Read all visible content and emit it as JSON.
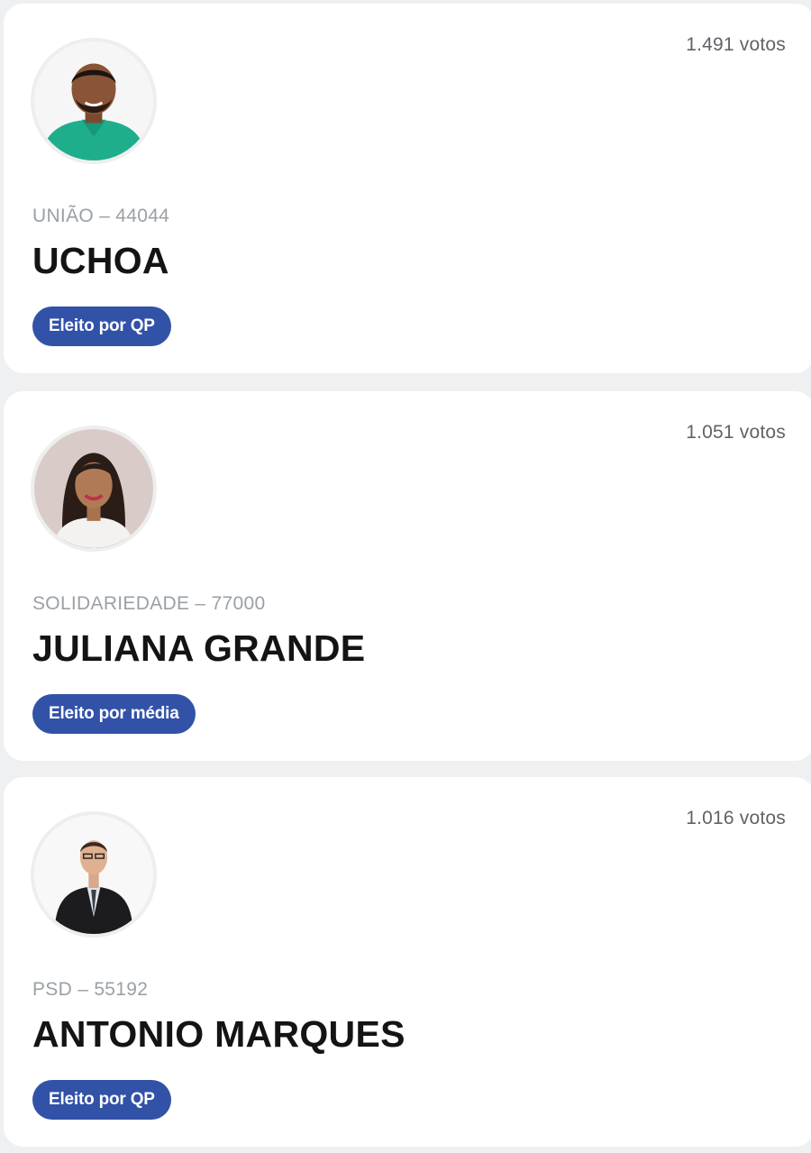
{
  "candidates": [
    {
      "votes": "1.491 votos",
      "party": "UNIÃO – 44044",
      "name": "UCHOA",
      "status": "Eleito por QP"
    },
    {
      "votes": "1.051 votos",
      "party": "SOLIDARIEDADE – 77000",
      "name": "JULIANA GRANDE",
      "status": "Eleito por média"
    },
    {
      "votes": "1.016 votos",
      "party": "PSD – 55192",
      "name": "ANTONIO MARQUES",
      "status": "Eleito por QP"
    }
  ],
  "colors": {
    "badge": "#3252a8",
    "card": "#ffffff",
    "background": "#eef0f2"
  }
}
